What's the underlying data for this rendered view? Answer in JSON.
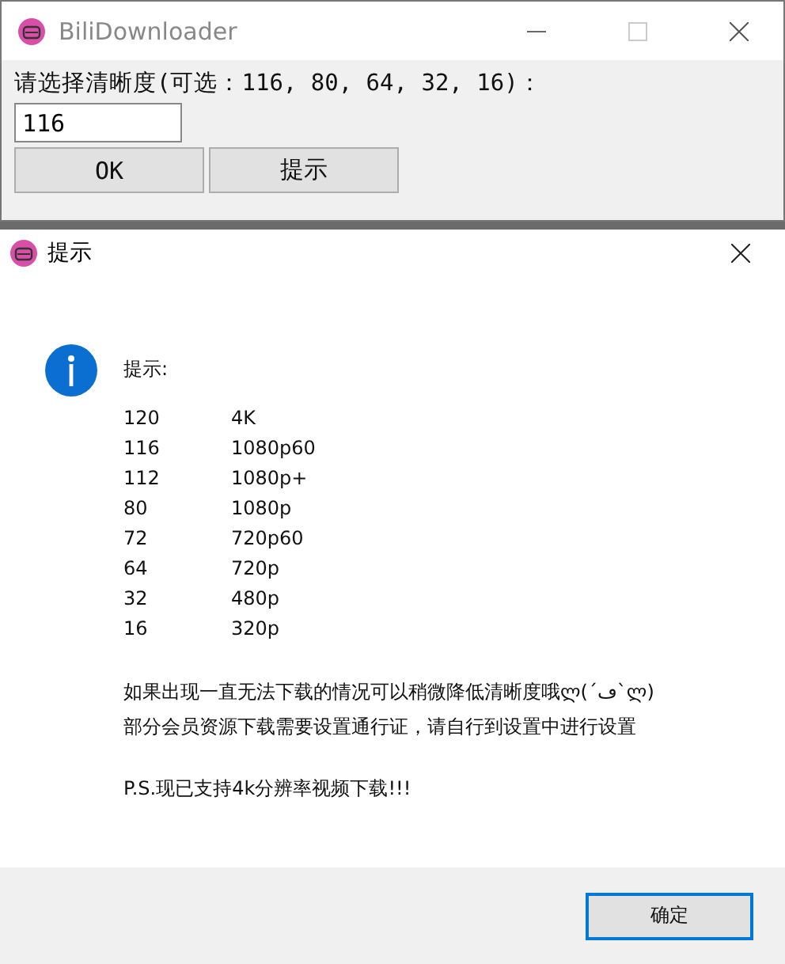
{
  "main_window": {
    "title": "BiliDownloader",
    "prompt": "请选择清晰度(可选：116, 80, 64, 32, 16)：",
    "input": {
      "value": "116"
    },
    "buttons": [
      "OK",
      "提示"
    ]
  },
  "dialog": {
    "title": "提示",
    "heading": "提示:",
    "rows": [
      {
        "code": "120",
        "quality": "4K"
      },
      {
        "code": "116",
        "quality": "1080p60"
      },
      {
        "code": "112",
        "quality": "1080p+"
      },
      {
        "code": "80",
        "quality": "1080p"
      },
      {
        "code": "72",
        "quality": "720p60"
      },
      {
        "code": "64",
        "quality": "720p"
      },
      {
        "code": "32",
        "quality": "480p"
      },
      {
        "code": "16",
        "quality": "320p"
      }
    ],
    "notes": [
      "如果出现一直无法下载的情况可以稍微降低清晰度哦ლ(´ڡ`ლ)",
      "部分会员资源下载需要设置通行证，请自行到设置中进行设置"
    ],
    "ps": "P.S.现已支持4k分辨率视频下载!!!",
    "ok_button": "确定"
  }
}
